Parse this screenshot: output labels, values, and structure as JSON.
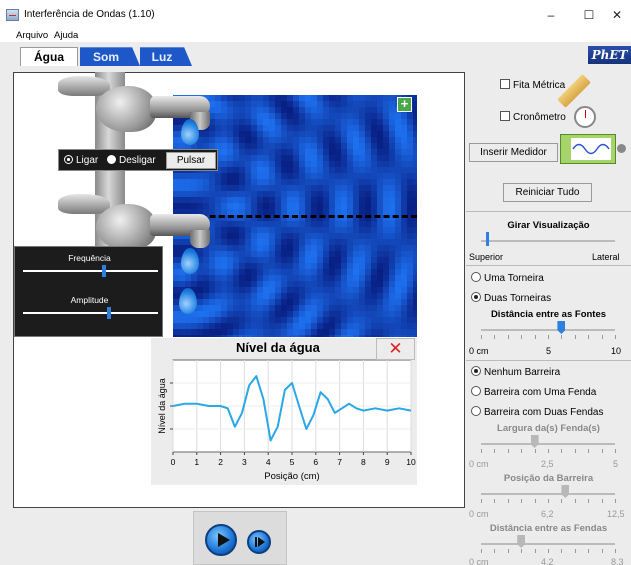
{
  "window": {
    "title": "Interferência de Ondas (1.10)",
    "minimize": "–",
    "maximize": "☐",
    "close": "✕"
  },
  "menu": {
    "items": [
      "Arquivo",
      "Ajuda"
    ]
  },
  "tabs": [
    {
      "label": "Água",
      "active": true
    },
    {
      "label": "Som",
      "active": false
    },
    {
      "label": "Luz",
      "active": false
    }
  ],
  "logo": "PhET",
  "source_controls": {
    "on_label": "Ligar",
    "off_label": "Desligar",
    "pulse_label": "Pulsar",
    "selected": "Ligar"
  },
  "wave_controls": {
    "frequency_label": "Frequência",
    "frequency_level": 0.6,
    "amplitude_label": "Amplitude",
    "amplitude_level": 0.64
  },
  "graph": {
    "title": "Nível da água",
    "close_icon": "✕",
    "chart_data": {
      "type": "line",
      "title": "Nível da água",
      "xlabel": "Posição (cm)",
      "ylabel": "Nível da água",
      "xlim": [
        0,
        10
      ],
      "ylim": [
        -1,
        1
      ],
      "x_ticks": [
        "0",
        "1",
        "2",
        "3",
        "4",
        "5",
        "6",
        "7",
        "8",
        "9",
        "10"
      ],
      "grid": true,
      "color": "#2aa7e6",
      "x": [
        0,
        0.5,
        1,
        1.5,
        2,
        2.3,
        2.6,
        2.9,
        3.2,
        3.5,
        3.8,
        4.1,
        4.4,
        4.7,
        5.0,
        5.3,
        5.6,
        5.9,
        6.2,
        6.5,
        6.8,
        7.1,
        7.4,
        7.7,
        8.0,
        8.5,
        9.0,
        9.5,
        10
      ],
      "y": [
        0.0,
        0.05,
        0.05,
        0.0,
        0.0,
        -0.05,
        -0.45,
        -0.15,
        0.45,
        0.65,
        0.15,
        -0.75,
        -0.45,
        0.35,
        0.5,
        0.0,
        -0.5,
        -0.2,
        0.3,
        0.15,
        -0.15,
        -0.05,
        0.05,
        -0.05,
        -0.1,
        -0.05,
        -0.1,
        -0.05,
        -0.1
      ]
    }
  },
  "tools": {
    "tape_label": "Fita Métrica",
    "stopwatch_label": "Cronômetro",
    "probe_button": "Inserir Medidor",
    "reset_button": "Reiniciar Tudo"
  },
  "rotate": {
    "title": "Girar Visualização",
    "min_label": "Superior",
    "max_label": "Lateral",
    "level": 0.0
  },
  "sources": {
    "one_label": "Uma Torneira",
    "two_label": "Duas Torneiras",
    "selected": "Duas Torneiras",
    "distance_title": "Distância entre as Fontes",
    "min": "0 cm",
    "mid": "5",
    "max": "10",
    "level": 0.6
  },
  "barriers": {
    "none_label": "Nenhum Barreira",
    "one_label": "Barreira com Uma Fenda",
    "two_label": "Barreira com Duas Fendas",
    "selected": "Nenhum Barreira",
    "width_title": "Largura da(s) Fenda(s)",
    "width_min": "0 cm",
    "width_mid": "2,5",
    "width_max": "5",
    "width_level": 0.4,
    "position_title": "Posição da Barreira",
    "position_min": "0 cm",
    "position_mid": "6,2",
    "position_max": "12,5",
    "position_level": 0.63,
    "slit_title": "Distância entre as Fendas",
    "slit_min": "0 cm",
    "slit_mid": "4,2",
    "slit_max": "8,3",
    "slit_level": 0.3
  },
  "playback": {
    "play_icon": "play-icon",
    "step_icon": "step-icon"
  }
}
